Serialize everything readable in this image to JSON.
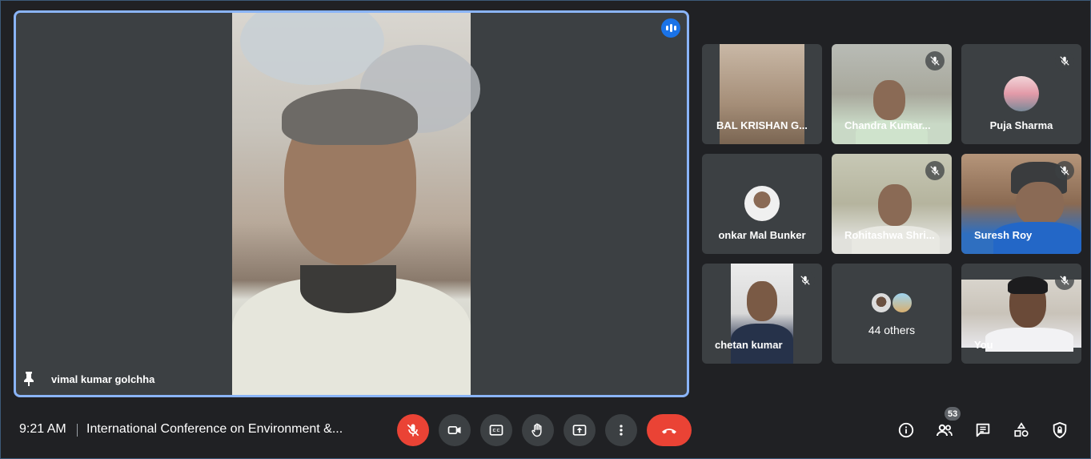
{
  "main_speaker": {
    "name": "vimal kumar golchha"
  },
  "participants": [
    {
      "name": "BAL KRISHAN G..."
    },
    {
      "name": "Chandra Kumar..."
    },
    {
      "name": "Puja Sharma"
    },
    {
      "name": "onkar Mal Bunker"
    },
    {
      "name": "Rohitashwa Shri..."
    },
    {
      "name": "Suresh Roy"
    },
    {
      "name": "chetan kumar"
    },
    {
      "name": "44 others"
    },
    {
      "name": "You"
    }
  ],
  "meeting": {
    "time": "9:21 AM",
    "title": "International Conference on Environment &..."
  },
  "controls": {
    "participant_count": "53"
  },
  "colors": {
    "accent": "#8ab4f8",
    "speaking": "#1a73e8",
    "danger": "#ea4335",
    "background": "#202124",
    "tile": "#3c4043"
  }
}
